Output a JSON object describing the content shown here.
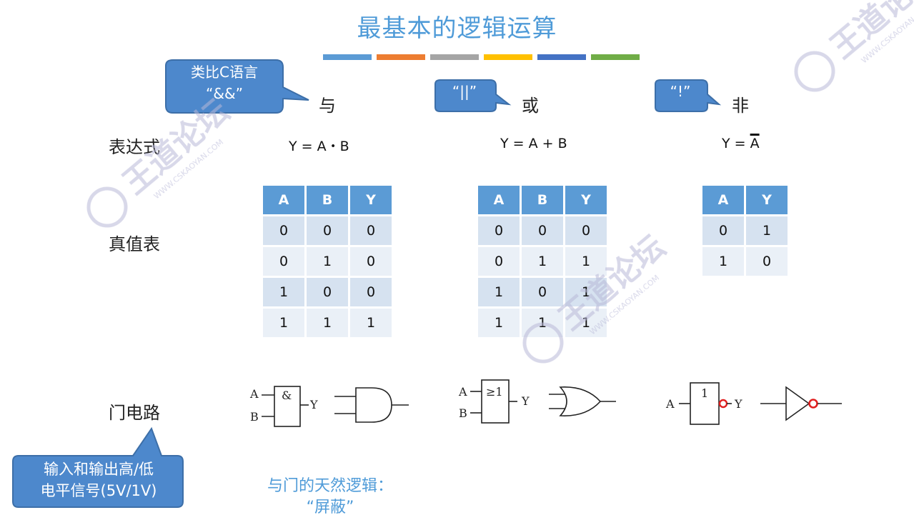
{
  "title": "最基本的逻辑运算",
  "color_bar": [
    "#5b9bd5",
    "#ed7d31",
    "#a5a5a5",
    "#ffc000",
    "#4472c4",
    "#70ad47"
  ],
  "callouts": {
    "c_analogy_line1": "类比C语言",
    "c_analogy_line2": "“&&”",
    "or_symbol": "“||”",
    "not_symbol": "“!”",
    "signal_line1": "输入和输出高/低",
    "signal_line2": "电平信号(5V/1V)"
  },
  "operations": {
    "and": "与",
    "or": "或",
    "not": "非"
  },
  "row_labels": {
    "expression": "表达式",
    "truth_table": "真值表",
    "gate_circuit": "门电路"
  },
  "expressions": {
    "and": "Y = A・B",
    "or": "Y = A + B",
    "not_prefix": "Y = ",
    "not_var": "A"
  },
  "tables": {
    "and": {
      "headers": [
        "A",
        "B",
        "Y"
      ],
      "rows": [
        [
          "0",
          "0",
          "0"
        ],
        [
          "0",
          "1",
          "0"
        ],
        [
          "1",
          "0",
          "0"
        ],
        [
          "1",
          "1",
          "1"
        ]
      ]
    },
    "or": {
      "headers": [
        "A",
        "B",
        "Y"
      ],
      "rows": [
        [
          "0",
          "0",
          "0"
        ],
        [
          "0",
          "1",
          "1"
        ],
        [
          "1",
          "0",
          "1"
        ],
        [
          "1",
          "1",
          "1"
        ]
      ]
    },
    "not": {
      "headers": [
        "A",
        "Y"
      ],
      "rows": [
        [
          "0",
          "1"
        ],
        [
          "1",
          "0"
        ]
      ]
    }
  },
  "gates": {
    "and_symbol": "&",
    "or_symbol": "≥1",
    "not_symbol": "1",
    "input_a": "A",
    "input_b": "B",
    "output_y": "Y"
  },
  "note": {
    "line1": "与门的天然逻辑：",
    "line2": "“屏蔽”"
  },
  "watermark": {
    "text": "王道论坛",
    "url": "WWW.CSKAOYAN.COM"
  }
}
